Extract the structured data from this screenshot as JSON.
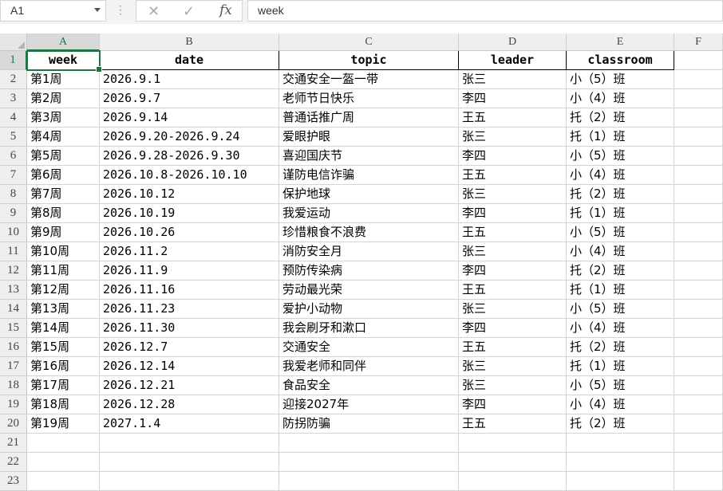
{
  "formula_bar": {
    "name_box": "A1",
    "cancel_icon": "close-icon",
    "enter_icon": "check-icon",
    "fx_label": "fx",
    "content": "week"
  },
  "columns": [
    "A",
    "B",
    "C",
    "D",
    "E",
    "F"
  ],
  "row_numbers": [
    "1",
    "2",
    "3",
    "4",
    "5",
    "6",
    "7",
    "8",
    "9",
    "10",
    "11",
    "12",
    "13",
    "14",
    "15",
    "16",
    "17",
    "18",
    "19",
    "20",
    "21",
    "22",
    "23"
  ],
  "table": {
    "headers": [
      "week",
      "date",
      "topic",
      "leader",
      "classroom"
    ],
    "rows": [
      [
        "第1周",
        "2026.9.1",
        "交通安全一盔一带",
        "张三",
        "小（5）班"
      ],
      [
        "第2周",
        "2026.9.7",
        "老师节日快乐",
        "李四",
        "小（4）班"
      ],
      [
        "第3周",
        "2026.9.14",
        "普通话推广周",
        "王五",
        "托（2）班"
      ],
      [
        "第4周",
        "2026.9.20-2026.9.24",
        "爱眼护眼",
        "张三",
        "托（1）班"
      ],
      [
        "第5周",
        "2026.9.28-2026.9.30",
        "喜迎国庆节",
        "李四",
        "小（5）班"
      ],
      [
        "第6周",
        "2026.10.8-2026.10.10",
        "谨防电信诈骗",
        "王五",
        "小（4）班"
      ],
      [
        "第7周",
        "2026.10.12",
        "保护地球",
        "张三",
        "托（2）班"
      ],
      [
        "第8周",
        "2026.10.19",
        "我爱运动",
        "李四",
        "托（1）班"
      ],
      [
        "第9周",
        "2026.10.26",
        "珍惜粮食不浪费",
        "王五",
        "小（5）班"
      ],
      [
        "第10周",
        "2026.11.2",
        "消防安全月",
        "张三",
        "小（4）班"
      ],
      [
        "第11周",
        "2026.11.9",
        "预防传染病",
        "李四",
        "托（2）班"
      ],
      [
        "第12周",
        "2026.11.16",
        "劳动最光荣",
        "王五",
        "托（1）班"
      ],
      [
        "第13周",
        "2026.11.23",
        "爱护小动物",
        "张三",
        "小（5）班"
      ],
      [
        "第14周",
        "2026.11.30",
        "我会刷牙和漱口",
        "李四",
        "小（4）班"
      ],
      [
        "第15周",
        "2026.12.7",
        "交通安全",
        "王五",
        "托（2）班"
      ],
      [
        "第16周",
        "2026.12.14",
        "我爱老师和同伴",
        "张三",
        "托（1）班"
      ],
      [
        "第17周",
        "2026.12.21",
        "食品安全",
        "张三",
        "小（5）班"
      ],
      [
        "第18周",
        "2026.12.28",
        "迎接2027年",
        "李四",
        "小（4）班"
      ],
      [
        "第19周",
        "2027.1.4",
        "防拐防骗",
        "王五",
        "托（2）班"
      ]
    ]
  },
  "selected_cell": "A1",
  "accent_color": "#217346"
}
